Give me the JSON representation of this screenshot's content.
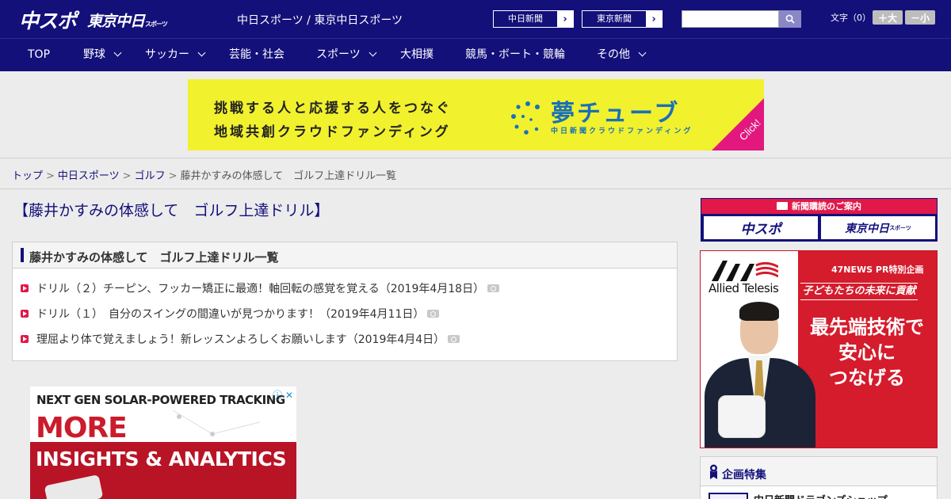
{
  "header": {
    "logo_main": "中スポ",
    "logo_tokyo": "東京中日",
    "logo_tokyo_small": "スポーツ",
    "site_title": "中日スポーツ / 東京中日スポーツ",
    "paper_buttons": [
      {
        "label": "中日新聞"
      },
      {
        "label": "東京新聞"
      }
    ],
    "search": {
      "placeholder": "",
      "value": ""
    },
    "font_size_label": "文字（0）",
    "font_larger": "＋大",
    "font_smaller": "－小"
  },
  "nav": {
    "items": [
      {
        "label": "TOP",
        "has_dropdown": false
      },
      {
        "label": "野球",
        "has_dropdown": true
      },
      {
        "label": "サッカー",
        "has_dropdown": true
      },
      {
        "label": "芸能・社会",
        "has_dropdown": false
      },
      {
        "label": "スポーツ",
        "has_dropdown": true
      },
      {
        "label": "大相撲",
        "has_dropdown": false
      },
      {
        "label": "競馬・ボート・競輪",
        "has_dropdown": false
      },
      {
        "label": "その他",
        "has_dropdown": true
      }
    ]
  },
  "banner": {
    "line1": "挑戦する人と応援する人をつなぐ",
    "line2": "地域共創クラウドファンディング",
    "logo": "夢チューブ",
    "sub": "中日新聞クラウドファンディング",
    "click": "Click!"
  },
  "breadcrumb": {
    "items": [
      "トップ",
      "中日スポーツ",
      "ゴルフ"
    ],
    "current": "藤井かすみの体感して　ゴルフ上達ドリル一覧",
    "separator": ">"
  },
  "main": {
    "page_title": "【藤井かすみの体感して　ゴルフ上達ドリル】",
    "list_title": "藤井かすみの体感して　ゴルフ上達ドリル一覧",
    "articles": [
      {
        "title": "ドリル（２）チーピン、フッカー矯正に最適！軸回転の感覚を覚える（2019年4月18日）",
        "has_photo": true
      },
      {
        "title": "ドリル（１）　自分のスイングの間違いが見つかります！（2019年4月11日）",
        "has_photo": true
      },
      {
        "title": "理屈より体で覚えましょう！新レッスンよろしくお願いします（2019年4月4日）",
        "has_photo": true
      }
    ]
  },
  "ad_bottom": {
    "line1": "NEXT GEN SOLAR-POWERED TRACKING",
    "line2": "MORE",
    "line3": "INSIGHTS & ANALYTICS",
    "adchoices": "ⓘ ✕"
  },
  "sidebar": {
    "subscription_header": "新聞購読のご案内",
    "subscription_logos": [
      "中スポ",
      "東京中日"
    ],
    "subscription_logo_small": "スポーツ",
    "ad": {
      "brand": "Allied Telesis",
      "pr_label": "47NEWS PR特別企画",
      "kicker": "子どもたちの未来に貢献",
      "headline": [
        "最先端技術で",
        "安心に",
        "つなげる"
      ]
    },
    "feature_title": "企画特集",
    "feature_item": "中日新聞ドラゴンズショップ"
  },
  "colors": {
    "navy": "#13107a",
    "accent_red": "#e2184a",
    "banner_yellow": "#f1f12e",
    "banner_blue": "#1970b9"
  }
}
